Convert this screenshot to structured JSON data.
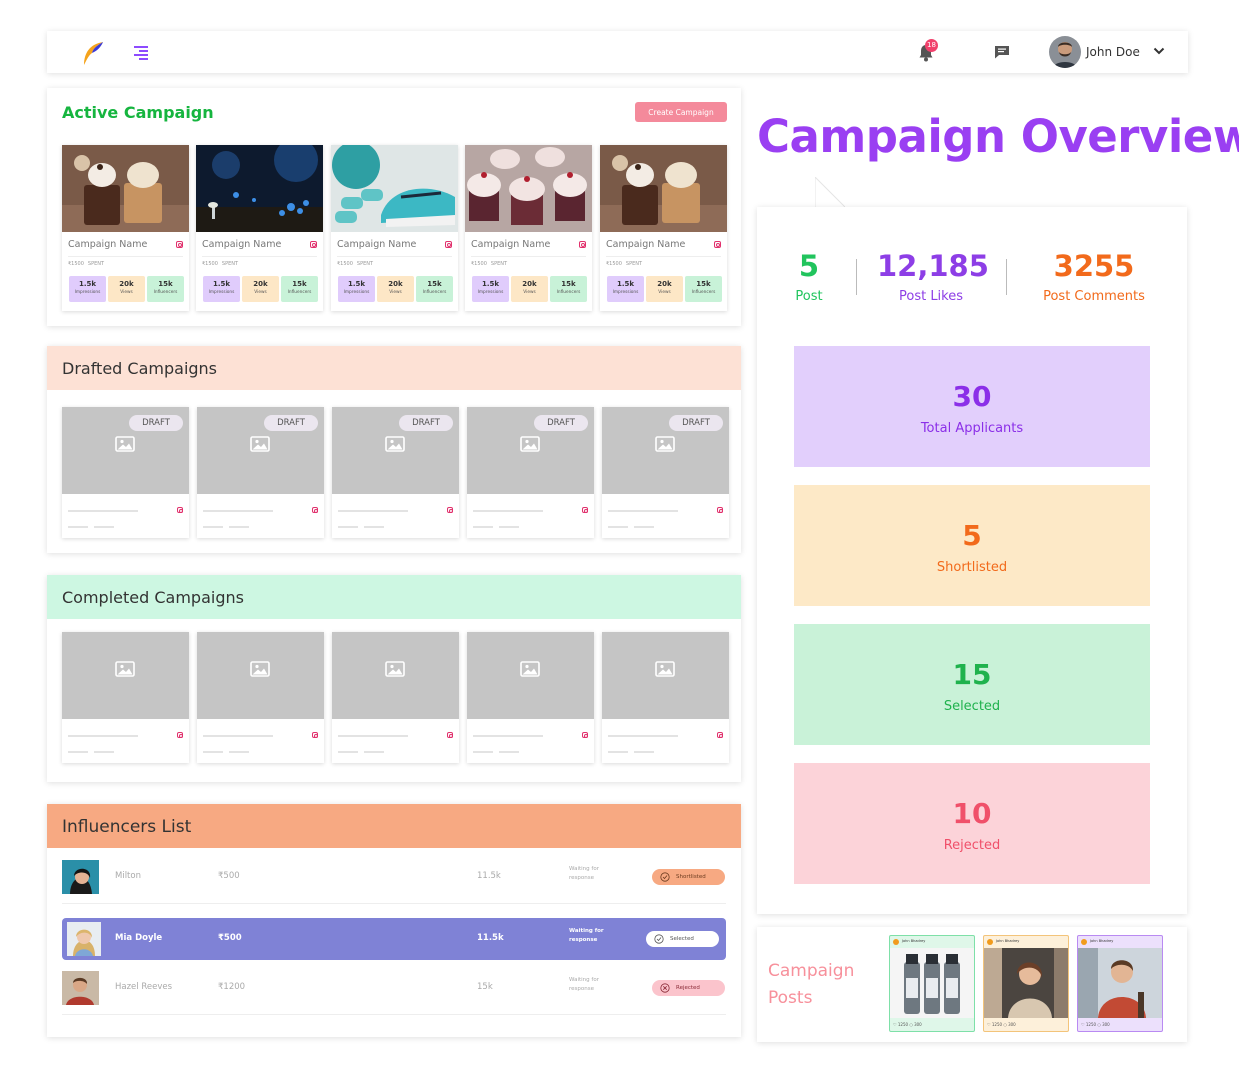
{
  "header": {
    "notification_count": "18",
    "user_name": "John Doe",
    "icons": [
      "logo",
      "menu-icon",
      "bell-icon",
      "chat-icon",
      "chevron-down-icon"
    ]
  },
  "active_campaign": {
    "title": "Active Campaign",
    "create_button": "Create Campaign",
    "campaigns": [
      {
        "name": "Campaign Name",
        "price": "₹1500",
        "spent_label": "SPENT",
        "impressions": "1.5k",
        "impressions_label": "Impressions",
        "views": "20k",
        "views_label": "Views",
        "influencers": "15k",
        "influencers_label": "Influencers"
      },
      {
        "name": "Campaign Name",
        "price": "₹1500",
        "spent_label": "SPENT",
        "impressions": "1.5k",
        "impressions_label": "Impressions",
        "views": "20k",
        "views_label": "Views",
        "influencers": "15k",
        "influencers_label": "Influencers"
      },
      {
        "name": "Campaign Name",
        "price": "₹1500",
        "spent_label": "SPENT",
        "impressions": "1.5k",
        "impressions_label": "Impressions",
        "views": "20k",
        "views_label": "Views",
        "influencers": "15k",
        "influencers_label": "Influencers"
      },
      {
        "name": "Campaign Name",
        "price": "₹1500",
        "spent_label": "SPENT",
        "impressions": "1.5k",
        "impressions_label": "Impressions",
        "views": "20k",
        "views_label": "Views",
        "influencers": "15k",
        "influencers_label": "Influencers"
      },
      {
        "name": "Campaign Name",
        "price": "₹1500",
        "spent_label": "SPENT",
        "impressions": "1.5k",
        "impressions_label": "Impressions",
        "views": "20k",
        "views_label": "Views",
        "influencers": "15k",
        "influencers_label": "Influencers"
      }
    ]
  },
  "drafted": {
    "title": "Drafted Campaigns",
    "tag": "DRAFT"
  },
  "completed": {
    "title": "Completed Campaigns"
  },
  "influencers": {
    "title": "Influencers List",
    "rows": [
      {
        "name": "Milton",
        "price": "₹500",
        "views": "11.5k",
        "waiting": "Waiting for response",
        "status": "Shortlisted"
      },
      {
        "name": "Mia Doyle",
        "price": "₹500",
        "views": "11.5k",
        "waiting": "Waiting for response",
        "status": "Selected"
      },
      {
        "name": "Hazel Reeves",
        "price": "₹1200",
        "views": "15k",
        "waiting": "Waiting for response",
        "status": "Rejected"
      }
    ]
  },
  "overview": {
    "title": "Campaign Overview",
    "post_count": "5",
    "post_label": "Post",
    "likes_count": "12,185",
    "likes_label": "Post Likes",
    "comments_count": "3255",
    "comments_label": "Post Comments",
    "applicants": {
      "value": "30",
      "label": "Total Applicants"
    },
    "shortlisted": {
      "value": "5",
      "label": "Shortlisted"
    },
    "selected": {
      "value": "15",
      "label": "Selected"
    },
    "rejected": {
      "value": "10",
      "label": "Rejected"
    }
  },
  "posts": {
    "title": "Campaign Posts",
    "items": [
      {
        "author": "John Bhadrey",
        "likes": "1250",
        "comments": "300"
      },
      {
        "author": "John Bhadrey",
        "likes": "1250",
        "comments": "300"
      },
      {
        "author": "John Bhadrey",
        "likes": "1250",
        "comments": "300"
      }
    ]
  },
  "colors": {
    "brand_purple": "#9a3ff2",
    "green": "#16b53f",
    "orange": "#f26a1b",
    "pink": "#f48a9b"
  }
}
